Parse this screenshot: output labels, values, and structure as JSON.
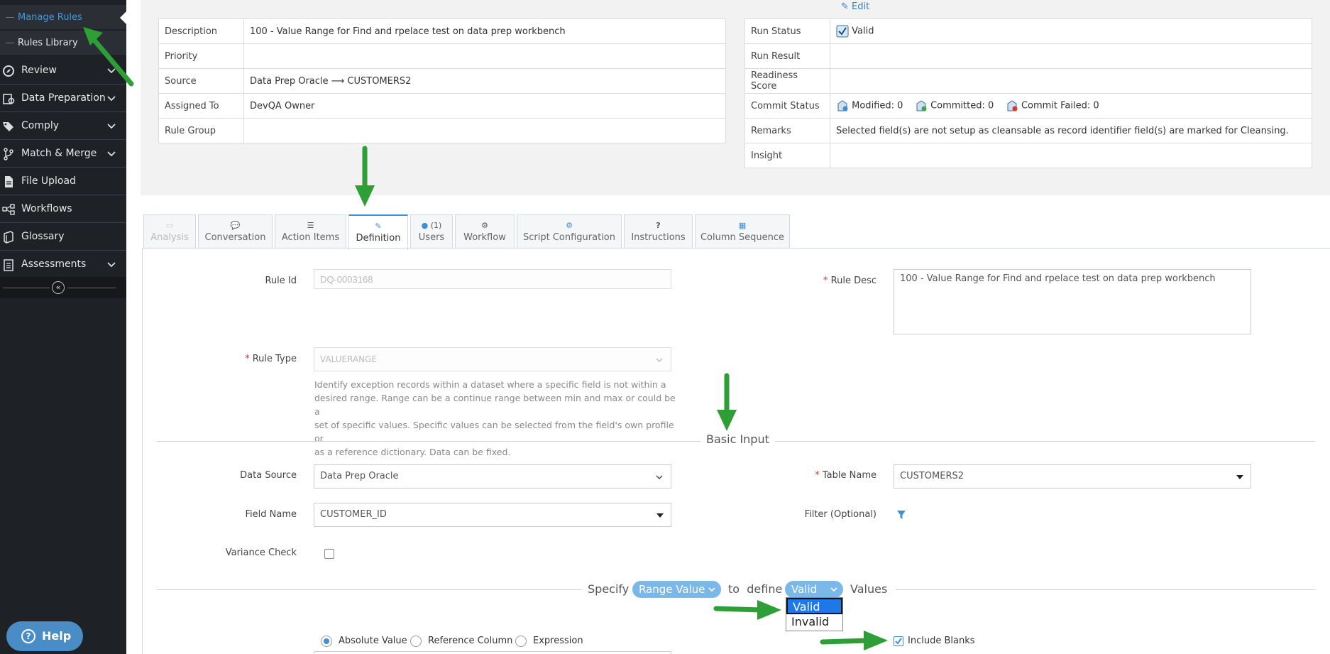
{
  "sidebar": {
    "sub_items": [
      {
        "label": "Manage Rules",
        "active": true
      },
      {
        "label": "Rules Library",
        "active": false
      }
    ],
    "nav": [
      {
        "label": "Review",
        "icon": "compass-icon",
        "has_children": true
      },
      {
        "label": "Data Preparation",
        "icon": "data-prep-icon",
        "has_children": true
      },
      {
        "label": "Comply",
        "icon": "tags-icon",
        "has_children": true
      },
      {
        "label": "Match & Merge",
        "icon": "merge-icon",
        "has_children": true
      },
      {
        "label": "File Upload",
        "icon": "file-icon",
        "has_children": false
      },
      {
        "label": "Workflows",
        "icon": "workflow-icon",
        "has_children": false
      },
      {
        "label": "Glossary",
        "icon": "book-icon",
        "has_children": false
      },
      {
        "label": "Assessments",
        "icon": "clipboard-icon",
        "has_children": true
      }
    ],
    "help_label": "Help"
  },
  "summary": {
    "edit_label": "Edit",
    "left": [
      {
        "key": "Description",
        "value": "100 - Value Range for Find and rpelace test on data prep workbench"
      },
      {
        "key": "Priority",
        "value": ""
      },
      {
        "key": "Source",
        "value": "Data Prep Oracle ⟶ CUSTOMERS2"
      },
      {
        "key": "Assigned To",
        "value": "DevQA Owner"
      },
      {
        "key": "Rule Group",
        "value": ""
      }
    ],
    "right": {
      "run_status_key": "Run Status",
      "run_status_value": "Valid",
      "run_result_key": "Run Result",
      "readiness_key": "Readiness Score",
      "commit_key": "Commit Status",
      "commit_modified": "Modified: 0",
      "commit_committed": "Committed: 0",
      "commit_failed": "Commit Failed: 0",
      "remarks_key": "Remarks",
      "remarks_value": "Selected field(s) are not setup as cleansable as record identifier field(s) are marked for Cleansing.",
      "insight_key": "Insight"
    }
  },
  "tabs": [
    {
      "label": "Analysis",
      "icon": "chat-board-icon",
      "state": "disabled"
    },
    {
      "label": "Conversation",
      "icon": "comment-icon",
      "state": "normal"
    },
    {
      "label": "Action Items",
      "icon": "list-icon",
      "state": "normal"
    },
    {
      "label": "Definition",
      "icon": "edit-icon",
      "state": "active"
    },
    {
      "label": "Users",
      "icon": "user-icon",
      "state": "normal",
      "count": "(1)"
    },
    {
      "label": "Workflow",
      "icon": "gears-icon",
      "state": "normal"
    },
    {
      "label": "Script Configuration",
      "icon": "gear-icon",
      "state": "normal"
    },
    {
      "label": "Instructions",
      "icon": "question-icon",
      "state": "normal"
    },
    {
      "label": "Column Sequence",
      "icon": "columns-icon",
      "state": "normal"
    }
  ],
  "form": {
    "rule_id_label": "Rule Id",
    "rule_id_value": "DQ-0003168",
    "rule_desc_label": "Rule Desc",
    "rule_desc_value": "100 - Value Range for Find and rpelace test on data prep workbench",
    "rule_type_label": "Rule Type",
    "rule_type_value": "VALUERANGE",
    "rule_type_help_1": "Identify exception records within a dataset where a specific field is not within a",
    "rule_type_help_2": "desired range. Range can be a continue range between min and max or could be a",
    "rule_type_help_3": "set of specific values. Specific values can be selected from the field's own profile or",
    "rule_type_help_4": "as a reference dictionary. Data can be fixed.",
    "basic_input_title": "Basic Input",
    "data_source_label": "Data Source",
    "data_source_value": "Data Prep Oracle",
    "table_name_label": "Table Name",
    "table_name_value": "CUSTOMERS2",
    "field_name_label": "Field Name",
    "field_name_value": "CUSTOMER_ID",
    "filter_label": "Filter (Optional)",
    "variance_label": "Variance Check",
    "variance_checked": false,
    "specify_word": "Specify",
    "range_value_select": "Range Value",
    "to_define_word": "to  define",
    "valid_select": "Valid",
    "values_word": "Values",
    "dropdown_options": [
      "Valid",
      "Invalid"
    ],
    "radio_options": [
      "Absolute Value",
      "Reference Column",
      "Expression"
    ],
    "radio_selected": "Absolute Value",
    "include_blanks_label": "Include Blanks",
    "include_blanks_checked": true
  },
  "colors": {
    "sidebar_bg": "#1e2126",
    "accent": "#3d8fd6",
    "pill": "#7ab8ea",
    "annotation_arrow": "#2e9e36",
    "required": "#d9362f"
  }
}
